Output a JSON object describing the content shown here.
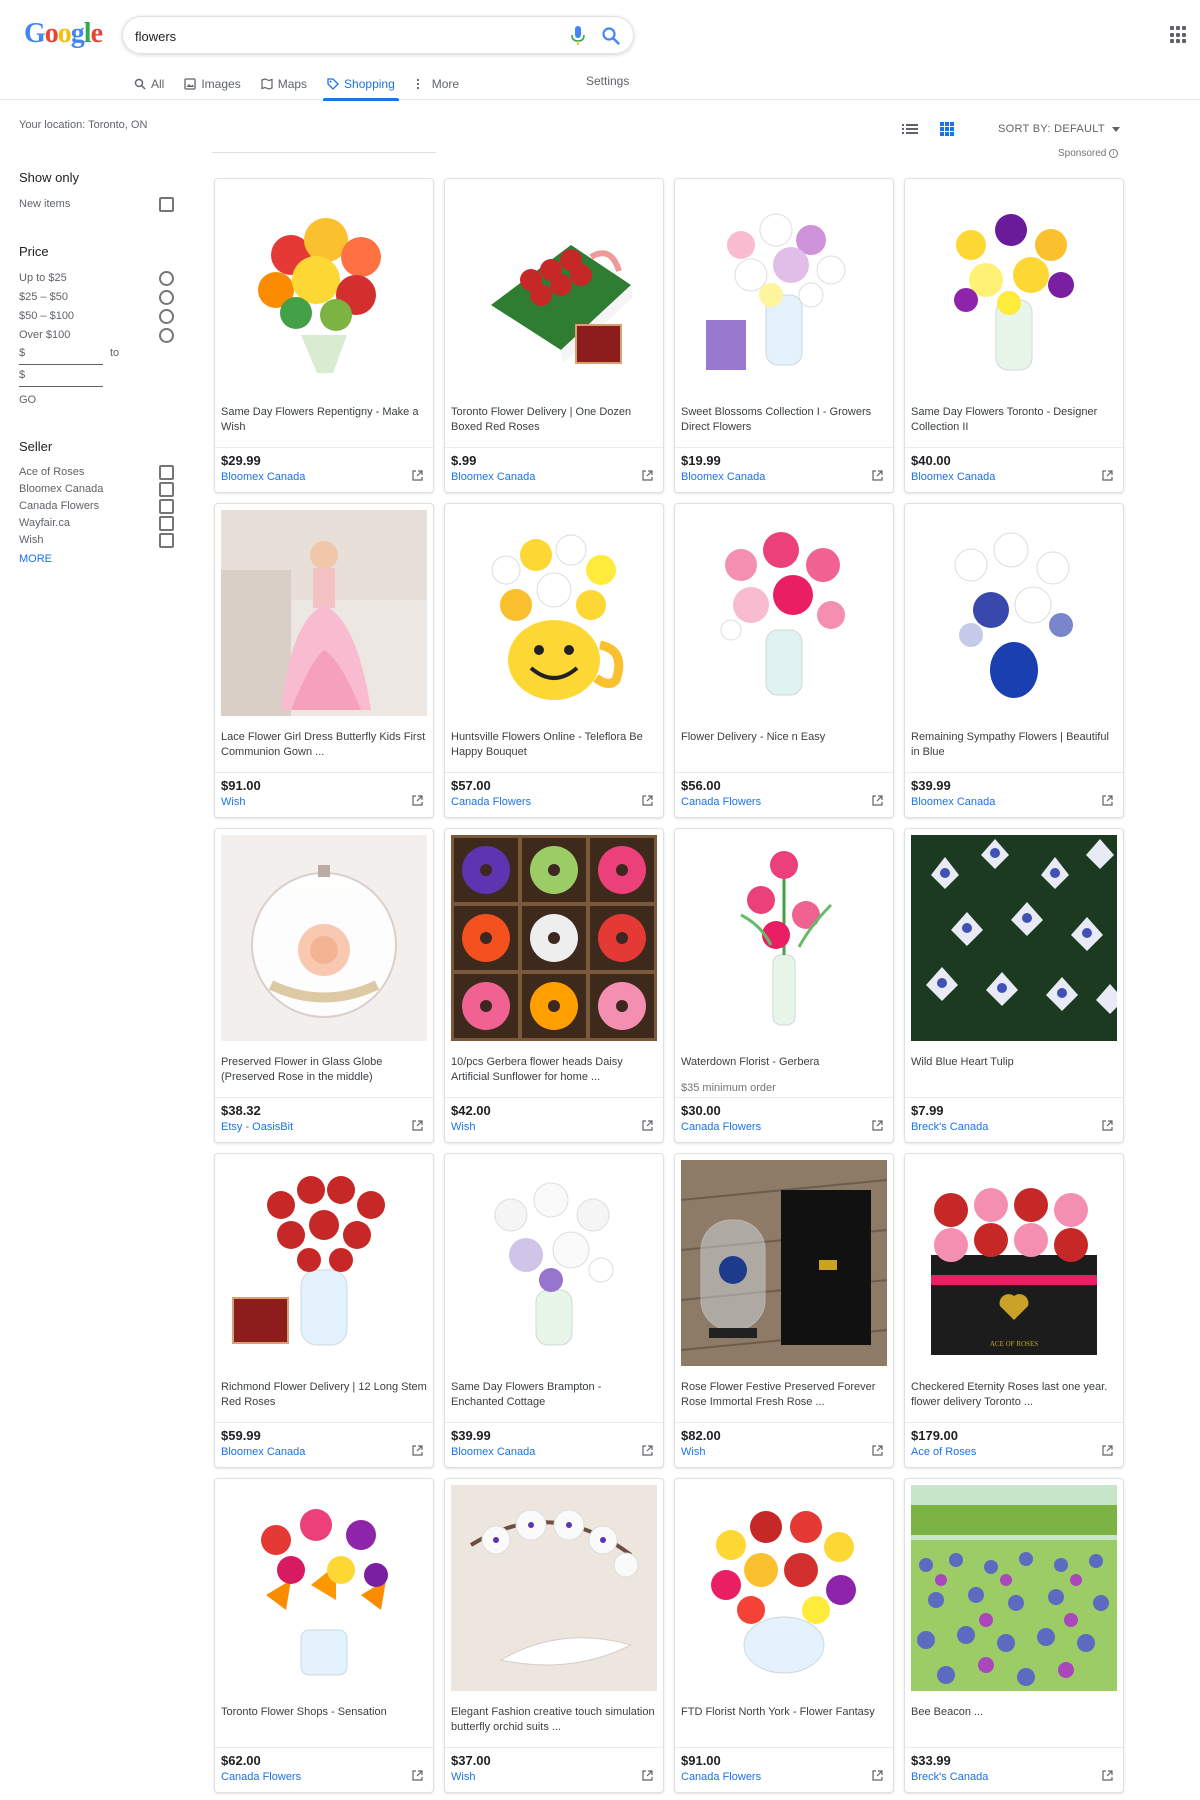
{
  "header": {
    "logo_text": "Google",
    "search": {
      "value": "flowers",
      "placeholder": ""
    },
    "tabs": [
      {
        "label": "All",
        "icon": "search-icon"
      },
      {
        "label": "Images",
        "icon": "image-icon"
      },
      {
        "label": "Maps",
        "icon": "map-icon"
      },
      {
        "label": "Shopping",
        "icon": "tag-icon",
        "active": true
      },
      {
        "label": "More",
        "icon": "more-vert-icon"
      }
    ],
    "settings_label": "Settings"
  },
  "toolbar": {
    "location": "Your location: Toronto, ON",
    "sort_label": "SORT BY: DEFAULT",
    "sponsored_label": "Sponsored"
  },
  "sidebar": {
    "show_only": {
      "heading": "Show only",
      "items": [
        "New items"
      ]
    },
    "price": {
      "heading": "Price",
      "options": [
        "Up to $25",
        "$25 – $50",
        "$50 – $100",
        "Over $100"
      ],
      "min_label": "$",
      "to_label": "to",
      "max_label": "$",
      "go_label": "GO"
    },
    "seller": {
      "heading": "Seller",
      "items": [
        "Ace of Roses",
        "Bloomex Canada",
        "Canada Flowers",
        "Wayfair.ca",
        "Wish"
      ],
      "more_label": "MORE"
    }
  },
  "colors": {
    "accent": "#1a73e8",
    "text": "#202124",
    "muted": "#5f6368"
  },
  "products": [
    {
      "title": "Same Day Flowers Repentigny - Make a Wish",
      "price": "$29.99",
      "seller": "Bloomex Canada",
      "note": "",
      "image": "mixed-bright-bouquet"
    },
    {
      "title": "Toronto Flower Delivery | One Dozen Boxed Red Roses",
      "price": "$.99",
      "seller": "Bloomex Canada",
      "note": "",
      "image": "boxed-red-roses"
    },
    {
      "title": "Sweet Blossoms Collection I - Growers Direct Flowers",
      "price": "$19.99",
      "seller": "Bloomex Canada",
      "note": "",
      "image": "white-purple-vase"
    },
    {
      "title": "Same Day Flowers Toronto - Designer Collection II",
      "price": "$40.00",
      "seller": "Bloomex Canada",
      "note": "",
      "image": "yellow-purple-vase"
    },
    {
      "title": "Lace Flower Girl Dress Butterfly Kids First Communion Gown ...",
      "price": "$91.00",
      "seller": "Wish",
      "note": "",
      "image": "pink-dress"
    },
    {
      "title": "Huntsville Flowers Online - Teleflora Be Happy Bouquet",
      "price": "$57.00",
      "seller": "Canada Flowers",
      "note": "",
      "image": "smiley-mug"
    },
    {
      "title": "Flower Delivery - Nice n Easy",
      "price": "$56.00",
      "seller": "Canada Flowers",
      "note": "",
      "image": "pink-carnations"
    },
    {
      "title": "Remaining Sympathy Flowers | Beautiful in Blue",
      "price": "$39.99",
      "seller": "Bloomex Canada",
      "note": "",
      "image": "white-blue-vase"
    },
    {
      "title": "Preserved Flower in Glass Globe (Preserved Rose in the middle)",
      "price": "$38.32",
      "seller": "Etsy - OasisBit",
      "note": "",
      "image": "glass-globe-rose"
    },
    {
      "title": "10/pcs Gerbera flower heads Daisy Artificial Sunflower for home ...",
      "price": "$42.00",
      "seller": "Wish",
      "note": "",
      "image": "gerbera-grid"
    },
    {
      "title": "Waterdown Florist - Gerbera",
      "price": "$30.00",
      "seller": "Canada Flowers",
      "note": "$35 minimum order",
      "image": "pink-gerbera-vase"
    },
    {
      "title": "Wild Blue Heart Tulip",
      "price": "$7.99",
      "seller": "Breck's Canada",
      "note": "",
      "image": "blue-tulips"
    },
    {
      "title": "Richmond Flower Delivery | 12 Long Stem Red Roses",
      "price": "$59.99",
      "seller": "Bloomex Canada",
      "note": "",
      "image": "red-roses-vase"
    },
    {
      "title": "Same Day Flowers Brampton - Enchanted Cottage",
      "price": "$39.99",
      "seller": "Bloomex Canada",
      "note": "",
      "image": "white-roses-vase"
    },
    {
      "title": "Rose Flower Festive Preserved Forever Rose Immortal Fresh Rose ...",
      "price": "$82.00",
      "seller": "Wish",
      "note": "",
      "image": "glass-dome-box"
    },
    {
      "title": "Checkered Eternity Roses last one year. flower delivery Toronto ...",
      "price": "$179.00",
      "seller": "Ace of Roses",
      "note": "",
      "image": "rose-box"
    },
    {
      "title": "Toronto Flower Shops - Sensation",
      "price": "$62.00",
      "seller": "Canada Flowers",
      "note": "",
      "image": "lily-bouquet"
    },
    {
      "title": "Elegant Fashion creative touch simulation butterfly orchid suits ...",
      "price": "$37.00",
      "seller": "Wish",
      "note": "",
      "image": "white-orchid"
    },
    {
      "title": "FTD Florist North York - Flower Fantasy",
      "price": "$91.00",
      "seller": "Canada Flowers",
      "note": "",
      "image": "bright-round-bouquet"
    },
    {
      "title": "Bee Beacon ...",
      "price": "$33.99",
      "seller": "Breck's Canada",
      "note": "",
      "image": "blue-flower-field"
    }
  ]
}
